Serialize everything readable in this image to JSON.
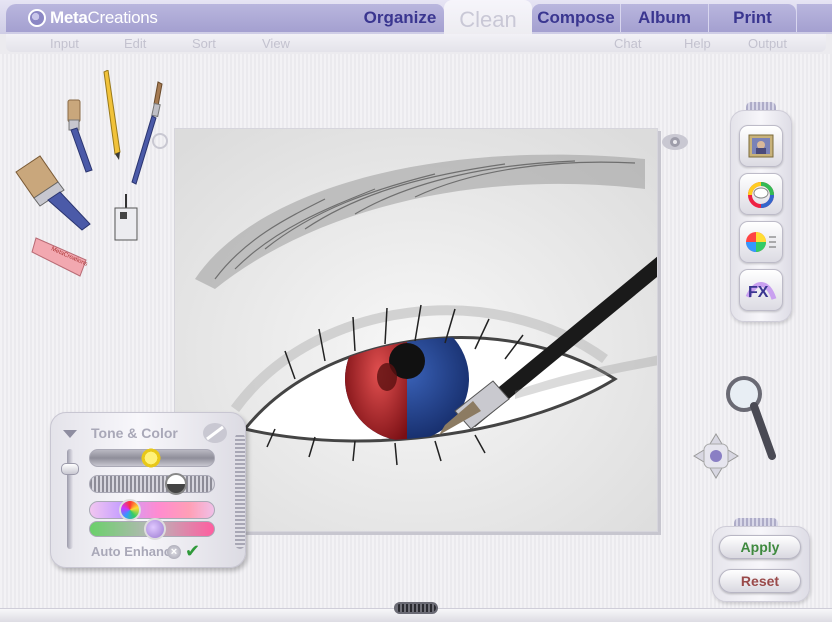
{
  "brand": {
    "name_bold": "Meta",
    "name_rest": "Creations",
    "logo_icon": "metacreations-logo-icon"
  },
  "tabs": [
    {
      "label": "Organize",
      "active": false
    },
    {
      "label": "Clean",
      "active": true
    },
    {
      "label": "Compose",
      "active": false
    },
    {
      "label": "Album",
      "active": false
    },
    {
      "label": "Print",
      "active": false
    }
  ],
  "submenu": [
    "Input",
    "Edit",
    "Sort",
    "View",
    "Chat",
    "Help",
    "Output"
  ],
  "tools": [
    "paint-brush-icon",
    "pencil-icon",
    "fine-brush-icon",
    "wide-brush-icon",
    "paint-can-icon",
    "eraser-icon"
  ],
  "eraser_text": "MetaCreations",
  "right_toolbar": [
    "photo-frame-icon",
    "color-wheel-bunny-icon",
    "color-adjust-icon",
    "fx-icon"
  ],
  "fx_label": "FX",
  "tone_color": {
    "title": "Tone & Color",
    "auto_enhance_label": "Auto Enhance",
    "brightness": 0.48,
    "contrast": 0.72,
    "hue": 0.28,
    "saturation": 0.52
  },
  "actions": {
    "apply": "Apply",
    "reset": "Reset"
  },
  "colors": {
    "tab": "#aca8d6",
    "tab_text": "#3a3690",
    "apply": "#3f8a3f",
    "reset": "#9a4a4a"
  }
}
